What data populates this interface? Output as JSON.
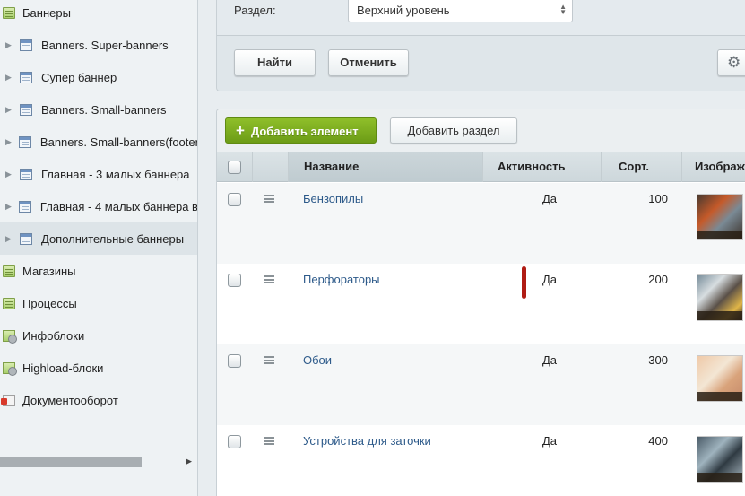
{
  "sidebar": {
    "items": [
      {
        "label": "Баннеры",
        "icon": "folder-icon",
        "level": "root"
      },
      {
        "label": "Banners. Super-banners",
        "icon": "list-icon",
        "level": "child"
      },
      {
        "label": "Супер баннер",
        "icon": "list-icon",
        "level": "child"
      },
      {
        "label": "Banners. Small-banners",
        "icon": "list-icon",
        "level": "child"
      },
      {
        "label": "Banners. Small-banners(footer)",
        "icon": "list-icon",
        "level": "child"
      },
      {
        "label": "Главная - 3 малых баннера",
        "icon": "list-icon",
        "level": "child"
      },
      {
        "label": "Главная - 4 малых баннера в",
        "icon": "list-icon",
        "level": "child"
      },
      {
        "label": "Дополнительные баннеры",
        "icon": "list-icon",
        "level": "child",
        "selected": true
      },
      {
        "label": "Магазины",
        "icon": "folder-icon",
        "level": "root"
      },
      {
        "label": "Процессы",
        "icon": "folder-icon",
        "level": "root"
      },
      {
        "label": "Инфоблоки",
        "icon": "gear-folder-icon",
        "level": "root"
      },
      {
        "label": "Highload-блоки",
        "icon": "gear-folder-icon",
        "level": "root"
      },
      {
        "label": "Документооборот",
        "icon": "document-flow-icon",
        "level": "root"
      }
    ]
  },
  "filter": {
    "section_label": "Раздел:",
    "section_value": "Верхний уровень",
    "find_label": "Найти",
    "cancel_label": "Отменить"
  },
  "toolbar": {
    "add_element_label": "Добавить элемент",
    "add_section_label": "Добавить раздел"
  },
  "table": {
    "columns": {
      "name": "Название",
      "active": "Активность",
      "sort": "Сорт.",
      "image": "Изображ"
    },
    "rows": [
      {
        "name": "Бензопилы",
        "active": "Да",
        "sort": "100",
        "image": "chainsaw-photo"
      },
      {
        "name": "Перфораторы",
        "active": "Да",
        "sort": "200",
        "image": "perforator-photo"
      },
      {
        "name": "Обои",
        "active": "Да",
        "sort": "300",
        "image": "wallpaper-photo"
      },
      {
        "name": "Устройства для заточки",
        "active": "Да",
        "sort": "400",
        "image": "sharpening-photo"
      }
    ]
  },
  "colors": {
    "accent_green": "#7fb01f",
    "link_blue": "#2d5a8a",
    "marker_red": "#b01c14"
  }
}
